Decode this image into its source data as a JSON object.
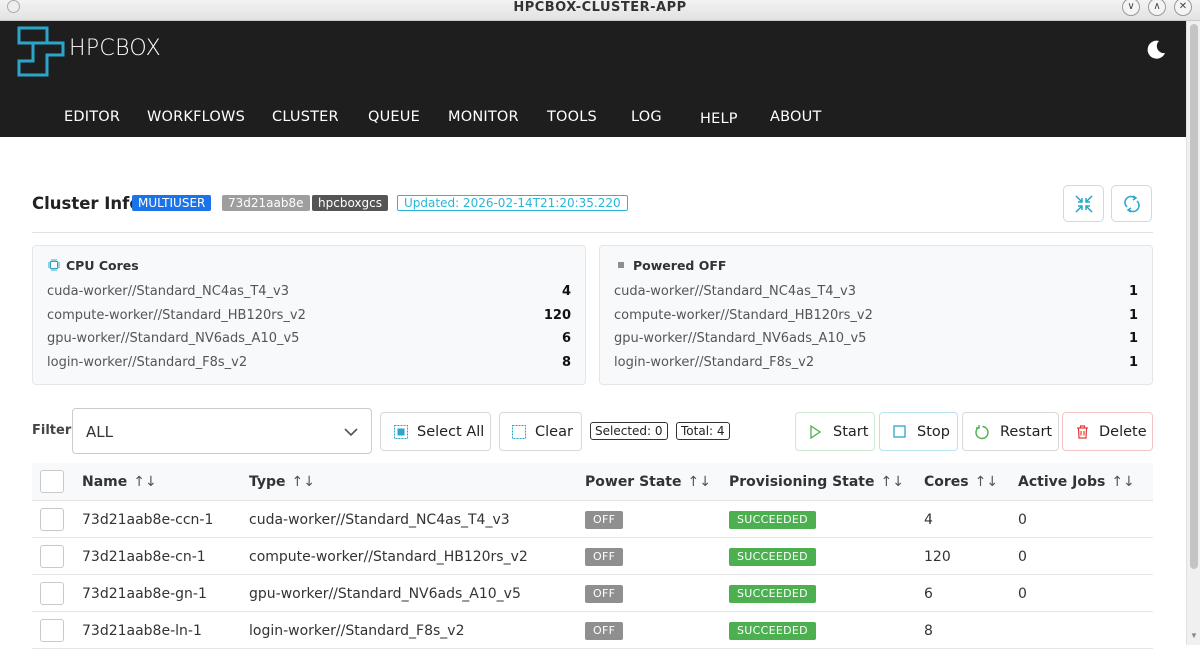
{
  "window": {
    "title": "HPCBOX-CLUSTER-APP"
  },
  "header": {
    "brand": "HPCBOX",
    "nav": [
      "EDITOR",
      "WORKFLOWS",
      "CLUSTER",
      "QUEUE",
      "MONITOR",
      "TOOLS",
      "LOG",
      "HELP",
      "ABOUT"
    ]
  },
  "cluster": {
    "title": "Cluster Info",
    "tags": [
      "MULTIUSER",
      "73d21aab8e",
      "hpcboxgcs"
    ],
    "updated": "Updated: 2026-02-14T21:20:35.220"
  },
  "cards": {
    "cpu": {
      "title": "CPU Cores",
      "rows": [
        {
          "label": "cuda-worker//Standard_NC4as_T4_v3",
          "value": "4"
        },
        {
          "label": "compute-worker//Standard_HB120rs_v2",
          "value": "120"
        },
        {
          "label": "gpu-worker//Standard_NV6ads_A10_v5",
          "value": "6"
        },
        {
          "label": "login-worker//Standard_F8s_v2",
          "value": "8"
        }
      ]
    },
    "power": {
      "title": "Powered OFF",
      "rows": [
        {
          "label": "cuda-worker//Standard_NC4as_T4_v3",
          "value": "1"
        },
        {
          "label": "compute-worker//Standard_HB120rs_v2",
          "value": "1"
        },
        {
          "label": "gpu-worker//Standard_NV6ads_A10_v5",
          "value": "1"
        },
        {
          "label": "login-worker//Standard_F8s_v2",
          "value": "1"
        }
      ]
    }
  },
  "toolbar": {
    "filter_label": "Filter",
    "filter_value": "ALL",
    "select_all": "Select All",
    "clear": "Clear",
    "selected": "Selected: 0",
    "total": "Total: 4",
    "start": "Start",
    "stop": "Stop",
    "restart": "Restart",
    "delete": "Delete"
  },
  "table": {
    "headers": [
      "Name",
      "Type",
      "Power State",
      "Provisioning State",
      "Cores",
      "Active Jobs"
    ],
    "sort_glyph": "↑↓",
    "rows": [
      {
        "name": "73d21aab8e-ccn-1",
        "type": "cuda-worker//Standard_NC4as_T4_v3",
        "power": "OFF",
        "prov": "SUCCEEDED",
        "cores": "4",
        "jobs": "0"
      },
      {
        "name": "73d21aab8e-cn-1",
        "type": "compute-worker//Standard_HB120rs_v2",
        "power": "OFF",
        "prov": "SUCCEEDED",
        "cores": "120",
        "jobs": "0"
      },
      {
        "name": "73d21aab8e-gn-1",
        "type": "gpu-worker//Standard_NV6ads_A10_v5",
        "power": "OFF",
        "prov": "SUCCEEDED",
        "cores": "6",
        "jobs": "0"
      },
      {
        "name": "73d21aab8e-ln-1",
        "type": "login-worker//Standard_F8s_v2",
        "power": "OFF",
        "prov": "SUCCEEDED",
        "cores": "8",
        "jobs": ""
      }
    ]
  },
  "colors": {
    "header_bg": "#1e1e1e",
    "accent": "#29b6d8",
    "tag_multiuser": "#1a73e8",
    "tag_id": "#9e9e9e",
    "tag_name": "#555555",
    "success": "#4caf50",
    "danger": "#e53935"
  },
  "icons": {
    "logo": "hpcbox-logo",
    "theme": "moon-icon",
    "collapse": "collapse-icon",
    "refresh": "refresh-icon",
    "cpu": "cpu-icon",
    "power": "square-icon"
  }
}
